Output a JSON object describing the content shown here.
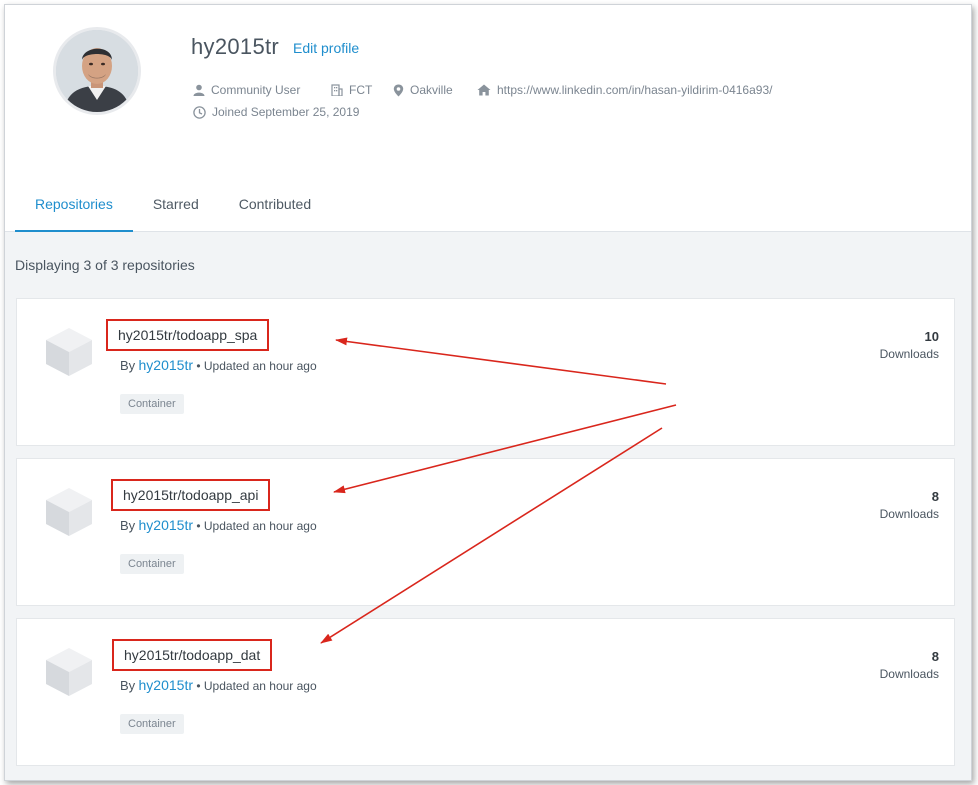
{
  "profile": {
    "username": "hy2015tr",
    "edit_label": "Edit profile",
    "role": "Community User",
    "company": "FCT",
    "location": "Oakville",
    "website": "https://www.linkedin.com/in/hasan-yildirim-0416a93/",
    "joined": "Joined September 25, 2019"
  },
  "tabs": [
    {
      "label": "Repositories",
      "active": true
    },
    {
      "label": "Starred",
      "active": false
    },
    {
      "label": "Contributed",
      "active": false
    }
  ],
  "repo_count_text": "Displaying 3 of 3 repositories",
  "repos": [
    {
      "name": "hy2015tr/todoapp_spa",
      "by": "By",
      "owner": "hy2015tr",
      "updated": "• Updated an hour ago",
      "tag": "Container",
      "downloads": "10",
      "downloads_label": "Downloads"
    },
    {
      "name": "hy2015tr/todoapp_api",
      "by": "By",
      "owner": "hy2015tr",
      "updated": "• Updated an hour ago",
      "tag": "Container",
      "downloads": "8",
      "downloads_label": "Downloads"
    },
    {
      "name": "hy2015tr/todoapp_dat",
      "by": "By",
      "owner": "hy2015tr",
      "updated": "• Updated an hour ago",
      "tag": "Container",
      "downloads": "8",
      "downloads_label": "Downloads"
    }
  ],
  "colors": {
    "accent": "#1f8ecd",
    "annotation": "#d9261c",
    "page_bg": "#f2f4f6"
  },
  "icons": [
    "user-icon",
    "building-icon",
    "map-pin-icon",
    "home-icon",
    "clock-icon",
    "repository-cube-icon"
  ]
}
